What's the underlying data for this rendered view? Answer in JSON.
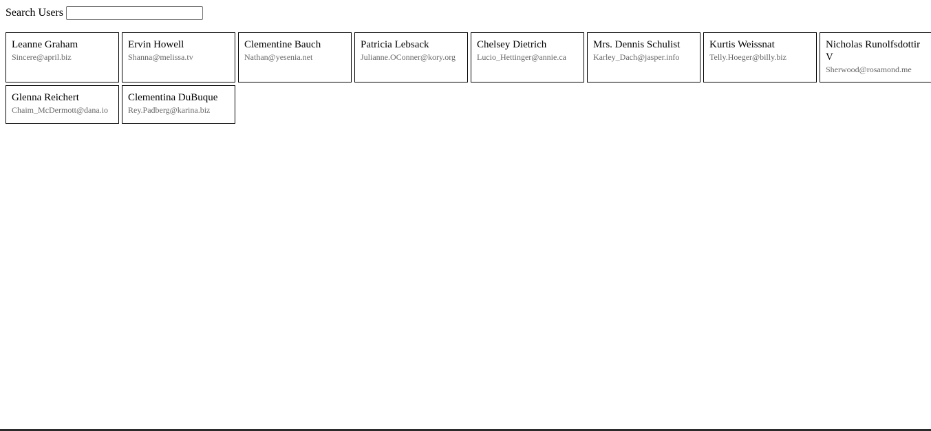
{
  "search": {
    "label": "Search Users",
    "value": "",
    "placeholder": ""
  },
  "users": [
    {
      "name": "Leanne Graham",
      "email": "Sincere@april.biz"
    },
    {
      "name": "Ervin Howell",
      "email": "Shanna@melissa.tv"
    },
    {
      "name": "Clementine Bauch",
      "email": "Nathan@yesenia.net"
    },
    {
      "name": "Patricia Lebsack",
      "email": "Julianne.OConner@kory.org"
    },
    {
      "name": "Chelsey Dietrich",
      "email": "Lucio_Hettinger@annie.ca"
    },
    {
      "name": "Mrs. Dennis Schulist",
      "email": "Karley_Dach@jasper.info"
    },
    {
      "name": "Kurtis Weissnat",
      "email": "Telly.Hoeger@billy.biz"
    },
    {
      "name": "Nicholas Runolfsdottir V",
      "email": "Sherwood@rosamond.me"
    },
    {
      "name": "Glenna Reichert",
      "email": "Chaim_McDermott@dana.io"
    },
    {
      "name": "Clementina DuBuque",
      "email": "Rey.Padberg@karina.biz"
    }
  ]
}
